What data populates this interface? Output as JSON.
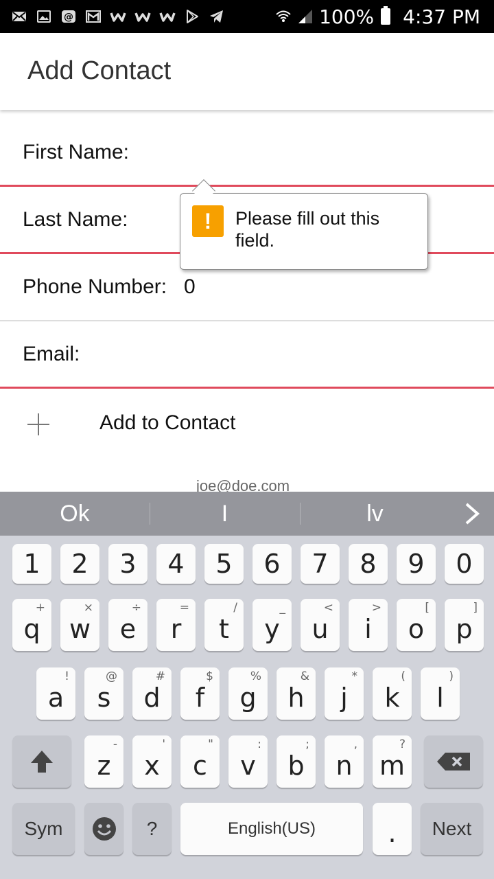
{
  "status_bar": {
    "icons": [
      "mail-icon",
      "gallery-icon",
      "at-sign-icon",
      "gmail-icon",
      "w-app-icon",
      "w-app-icon",
      "w-app-icon",
      "play-store-icon",
      "telegram-icon",
      "wifi-icon",
      "signal-icon",
      "battery-icon"
    ],
    "battery": "100%",
    "time": "4:37 PM"
  },
  "app_bar": {
    "title": "Add Contact"
  },
  "form": {
    "first_name": {
      "label": "First Name:",
      "value": ""
    },
    "last_name": {
      "label": "Last Name:",
      "value": ""
    },
    "phone": {
      "label": "Phone Number:",
      "value": "0"
    },
    "email": {
      "label": "Email:",
      "value": ""
    }
  },
  "add_button": {
    "label": "Add to Contact"
  },
  "email_hint": "joe@doe.com",
  "tooltip": {
    "text": "Please fill out this field."
  },
  "colors": {
    "error_underline": "#e04a5c",
    "warning": "#f7a000",
    "keyboard_bg": "#d1d3da",
    "suggestion_bar": "#95969c"
  },
  "keyboard": {
    "suggestions": [
      "Ok",
      "I",
      "lv"
    ],
    "number_row": [
      "1",
      "2",
      "3",
      "4",
      "5",
      "6",
      "7",
      "8",
      "9",
      "0"
    ],
    "row1": [
      {
        "key": "q",
        "sec": "+"
      },
      {
        "key": "w",
        "sec": "×"
      },
      {
        "key": "e",
        "sec": "÷"
      },
      {
        "key": "r",
        "sec": "="
      },
      {
        "key": "t",
        "sec": "/"
      },
      {
        "key": "y",
        "sec": "_"
      },
      {
        "key": "u",
        "sec": "<"
      },
      {
        "key": "i",
        "sec": ">"
      },
      {
        "key": "o",
        "sec": "["
      },
      {
        "key": "p",
        "sec": "]"
      }
    ],
    "row2": [
      {
        "key": "a",
        "sec": "!"
      },
      {
        "key": "s",
        "sec": "@"
      },
      {
        "key": "d",
        "sec": "#"
      },
      {
        "key": "f",
        "sec": "$"
      },
      {
        "key": "g",
        "sec": "%"
      },
      {
        "key": "h",
        "sec": "&"
      },
      {
        "key": "j",
        "sec": "*"
      },
      {
        "key": "k",
        "sec": "("
      },
      {
        "key": "l",
        "sec": ")"
      }
    ],
    "row3": [
      {
        "key": "z",
        "sec": "-"
      },
      {
        "key": "x",
        "sec": "'"
      },
      {
        "key": "c",
        "sec": "\""
      },
      {
        "key": "v",
        "sec": ":"
      },
      {
        "key": "b",
        "sec": ";"
      },
      {
        "key": "n",
        "sec": ","
      },
      {
        "key": "m",
        "sec": "?"
      }
    ],
    "sym_label": "Sym",
    "question_label": "?",
    "space_label": "English(US)",
    "period_label": ".",
    "next_label": "Next"
  }
}
